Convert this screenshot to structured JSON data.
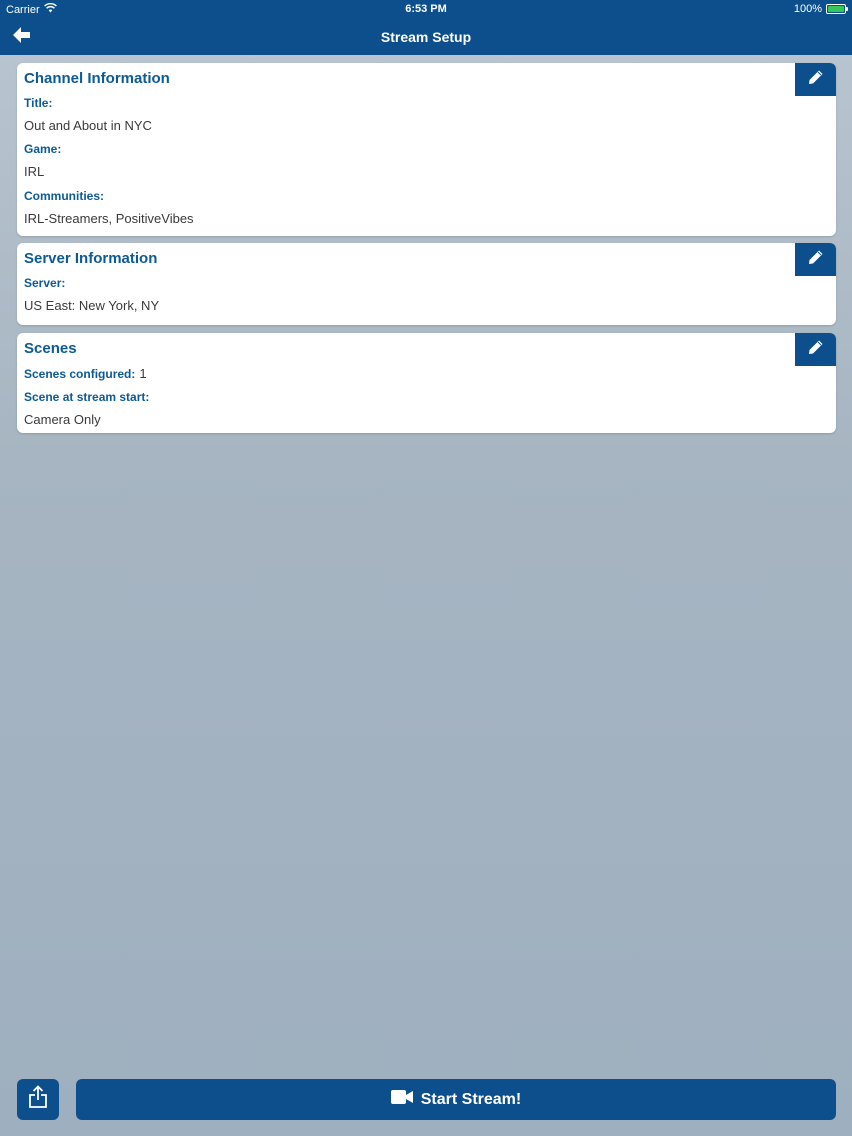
{
  "status_bar": {
    "carrier": "Carrier",
    "time": "6:53 PM",
    "battery": "100%"
  },
  "nav": {
    "title": "Stream Setup"
  },
  "channel": {
    "title": "Channel Information",
    "title_label": "Title:",
    "title_value": "Out and About in NYC",
    "game_label": "Game:",
    "game_value": "IRL",
    "communities_label": "Communities:",
    "communities_value": "IRL-Streamers, PositiveVibes"
  },
  "server": {
    "title": "Server Information",
    "server_label": "Server:",
    "server_value": "US East: New York, NY"
  },
  "scenes": {
    "title": "Scenes",
    "configured_label": "Scenes configured:",
    "configured_value": "1",
    "start_label": "Scene at stream start:",
    "start_value": "Camera Only"
  },
  "footer": {
    "start_label": "Start Stream!"
  },
  "colors": {
    "primary": "#0d4f8c",
    "heading": "#0d5a96",
    "background": "#a7b5c2",
    "battery": "#34c759"
  },
  "icons": [
    "wifi-icon",
    "battery-icon",
    "back-arrow-icon",
    "pencil-icon",
    "share-icon",
    "video-camera-icon"
  ]
}
